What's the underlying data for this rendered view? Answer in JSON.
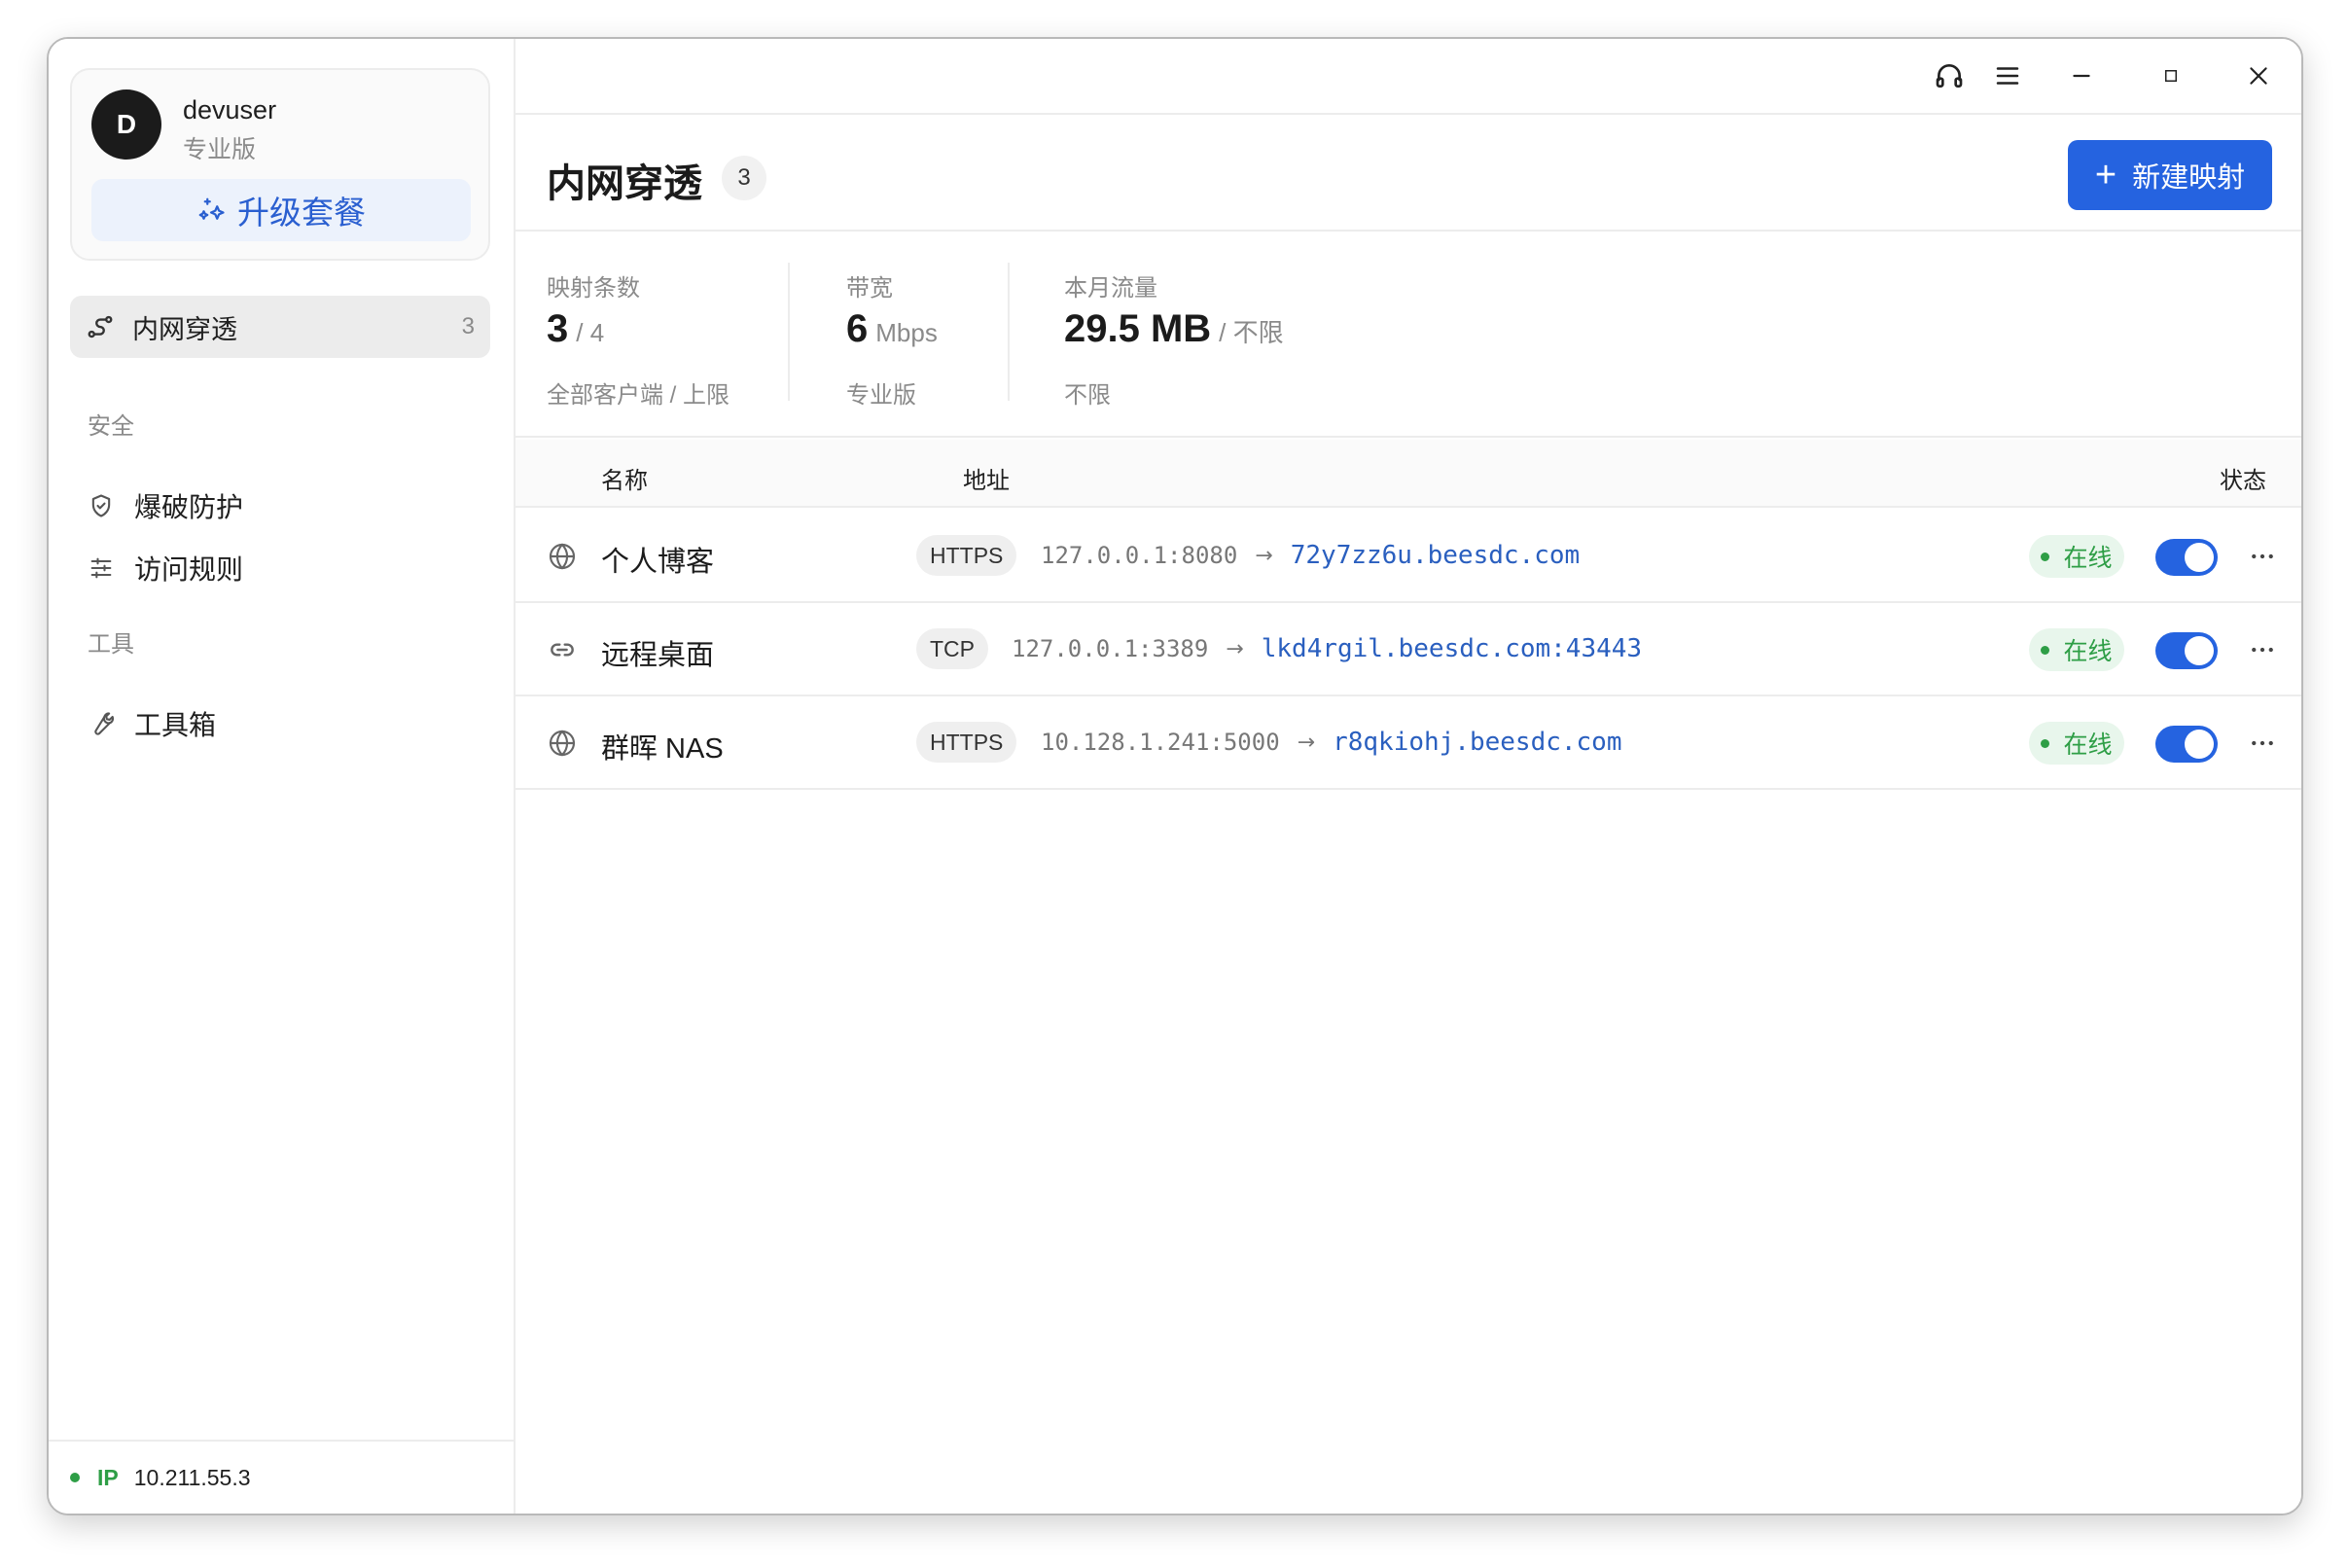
{
  "user": {
    "avatar_letter": "D",
    "username": "devuser",
    "plan": "专业版",
    "upgrade_label": "升级套餐"
  },
  "sidebar": {
    "active_item": {
      "label": "内网穿透",
      "count": "3",
      "icon": "tunnel-icon"
    },
    "sections": [
      {
        "title": "安全",
        "items": [
          {
            "label": "爆破防护",
            "icon": "shield-icon"
          },
          {
            "label": "访问规则",
            "icon": "sliders-icon"
          }
        ]
      },
      {
        "title": "工具",
        "items": [
          {
            "label": "工具箱",
            "icon": "wrench-icon"
          }
        ]
      }
    ],
    "footer": {
      "ip_label": "IP",
      "ip_value": "10.211.55.3"
    }
  },
  "titlebar": {
    "icons": [
      "headset-icon",
      "menu-icon",
      "minimize-icon",
      "maximize-icon",
      "close-icon"
    ]
  },
  "header": {
    "title": "内网穿透",
    "count": "3",
    "new_button_label": "新建映射"
  },
  "stats": [
    {
      "label": "映射条数",
      "big": "3",
      "small": "/ 4",
      "sub": "全部客户端 / 上限"
    },
    {
      "label": "带宽",
      "big": "6",
      "small": "Mbps",
      "sub": "专业版"
    },
    {
      "label": "本月流量",
      "big": "29.5 MB",
      "small": "/ 不限",
      "sub": "不限"
    }
  ],
  "table": {
    "columns": {
      "name": "名称",
      "address": "地址",
      "status": "状态"
    },
    "rows": [
      {
        "icon": "globe-icon",
        "name": "个人博客",
        "protocol": "HTTPS",
        "local": "127.0.0.1:8080",
        "remote": "72y7zz6u.beesdc.com",
        "status": "在线",
        "enabled": true
      },
      {
        "icon": "link-icon",
        "name": "远程桌面",
        "protocol": "TCP",
        "local": "127.0.0.1:3389",
        "remote": "lkd4rgil.beesdc.com:43443",
        "status": "在线",
        "enabled": true
      },
      {
        "icon": "globe-icon",
        "name": "群晖 NAS",
        "protocol": "HTTPS",
        "local": "10.128.1.241:5000",
        "remote": "r8qkiohj.beesdc.com",
        "status": "在线",
        "enabled": true
      }
    ]
  },
  "colors": {
    "accent": "#2563e0",
    "online": "#2e9e46",
    "link": "#2a5fbf"
  }
}
